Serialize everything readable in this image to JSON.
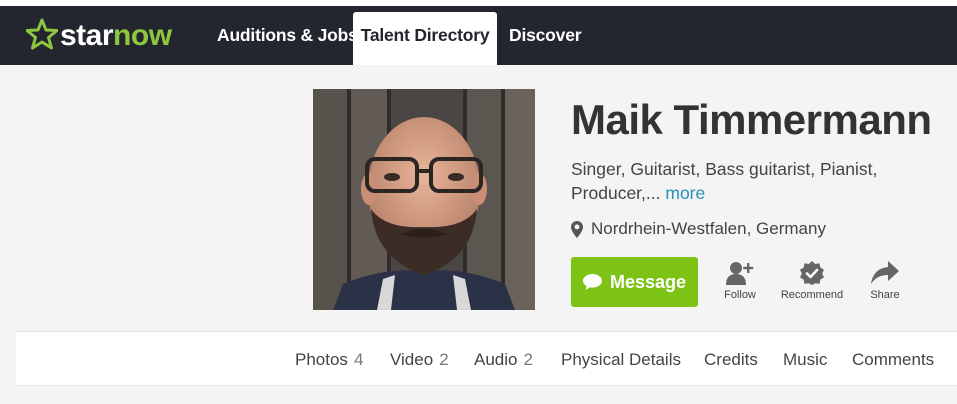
{
  "brand": {
    "logo_star": "star",
    "logo_now": "now",
    "icon": "star-icon",
    "colors": {
      "green": "#8dc63f",
      "nav_bg": "#23262e",
      "button_green": "#7dc316",
      "link_blue": "#2a8fbd"
    }
  },
  "nav": {
    "auditions": "Auditions & Jobs",
    "talent": "Talent Directory",
    "discover": "Discover"
  },
  "profile": {
    "name": "Maik Timmermann",
    "roles": "Singer, Guitarist, Bass guitarist, Pianist, Producer,...",
    "more": "more",
    "location": "Nordrhein-Westfalen, Germany"
  },
  "actions": {
    "message": "Message",
    "follow": "Follow",
    "recommend": "Recommend",
    "share": "Share"
  },
  "tabs": {
    "photos": {
      "label": "Photos",
      "count": "4"
    },
    "video": {
      "label": "Video",
      "count": "2"
    },
    "audio": {
      "label": "Audio",
      "count": "2"
    },
    "physical": {
      "label": "Physical Details"
    },
    "credits": {
      "label": "Credits"
    },
    "music": {
      "label": "Music"
    },
    "comments": {
      "label": "Comments"
    }
  }
}
